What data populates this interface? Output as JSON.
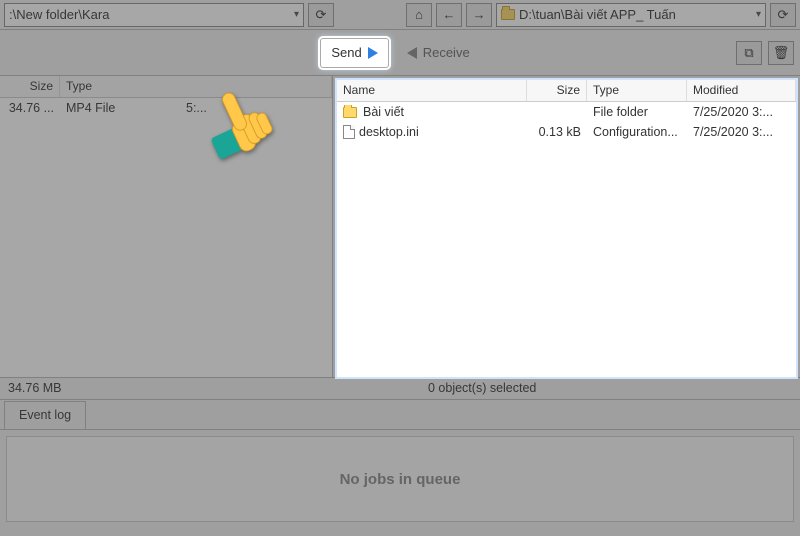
{
  "addr": {
    "left_path": ":\\New folder\\Kara",
    "right_path": "D:\\tuan\\Bài viết APP_ Tuấn"
  },
  "actions": {
    "send_label": "Send",
    "receive_label": "Receive"
  },
  "left_pane": {
    "cols": {
      "size": "Size",
      "type": "Type"
    },
    "rows": [
      {
        "size": "34.76 ...",
        "type": "MP4 File",
        "date": "5:..."
      }
    ]
  },
  "right_pane": {
    "cols": {
      "name": "Name",
      "size": "Size",
      "type": "Type",
      "modified": "Modified"
    },
    "rows": [
      {
        "name": "Bài viết",
        "size": "",
        "type": "File folder",
        "modified": "7/25/2020 3:..."
      },
      {
        "name": "desktop.ini",
        "size": "0.13 kB",
        "type": "Configuration...",
        "modified": "7/25/2020 3:..."
      }
    ]
  },
  "status": {
    "left": "34.76 MB",
    "right": "0 object(s) selected"
  },
  "tabs": {
    "event_log": "Event log"
  },
  "queue": {
    "empty": "No jobs in queue"
  },
  "glyphs": {
    "refresh": "⟳",
    "home": "⌂",
    "back": "←",
    "fwd": "→",
    "newwin": "⧉",
    "trash": "🗑"
  }
}
